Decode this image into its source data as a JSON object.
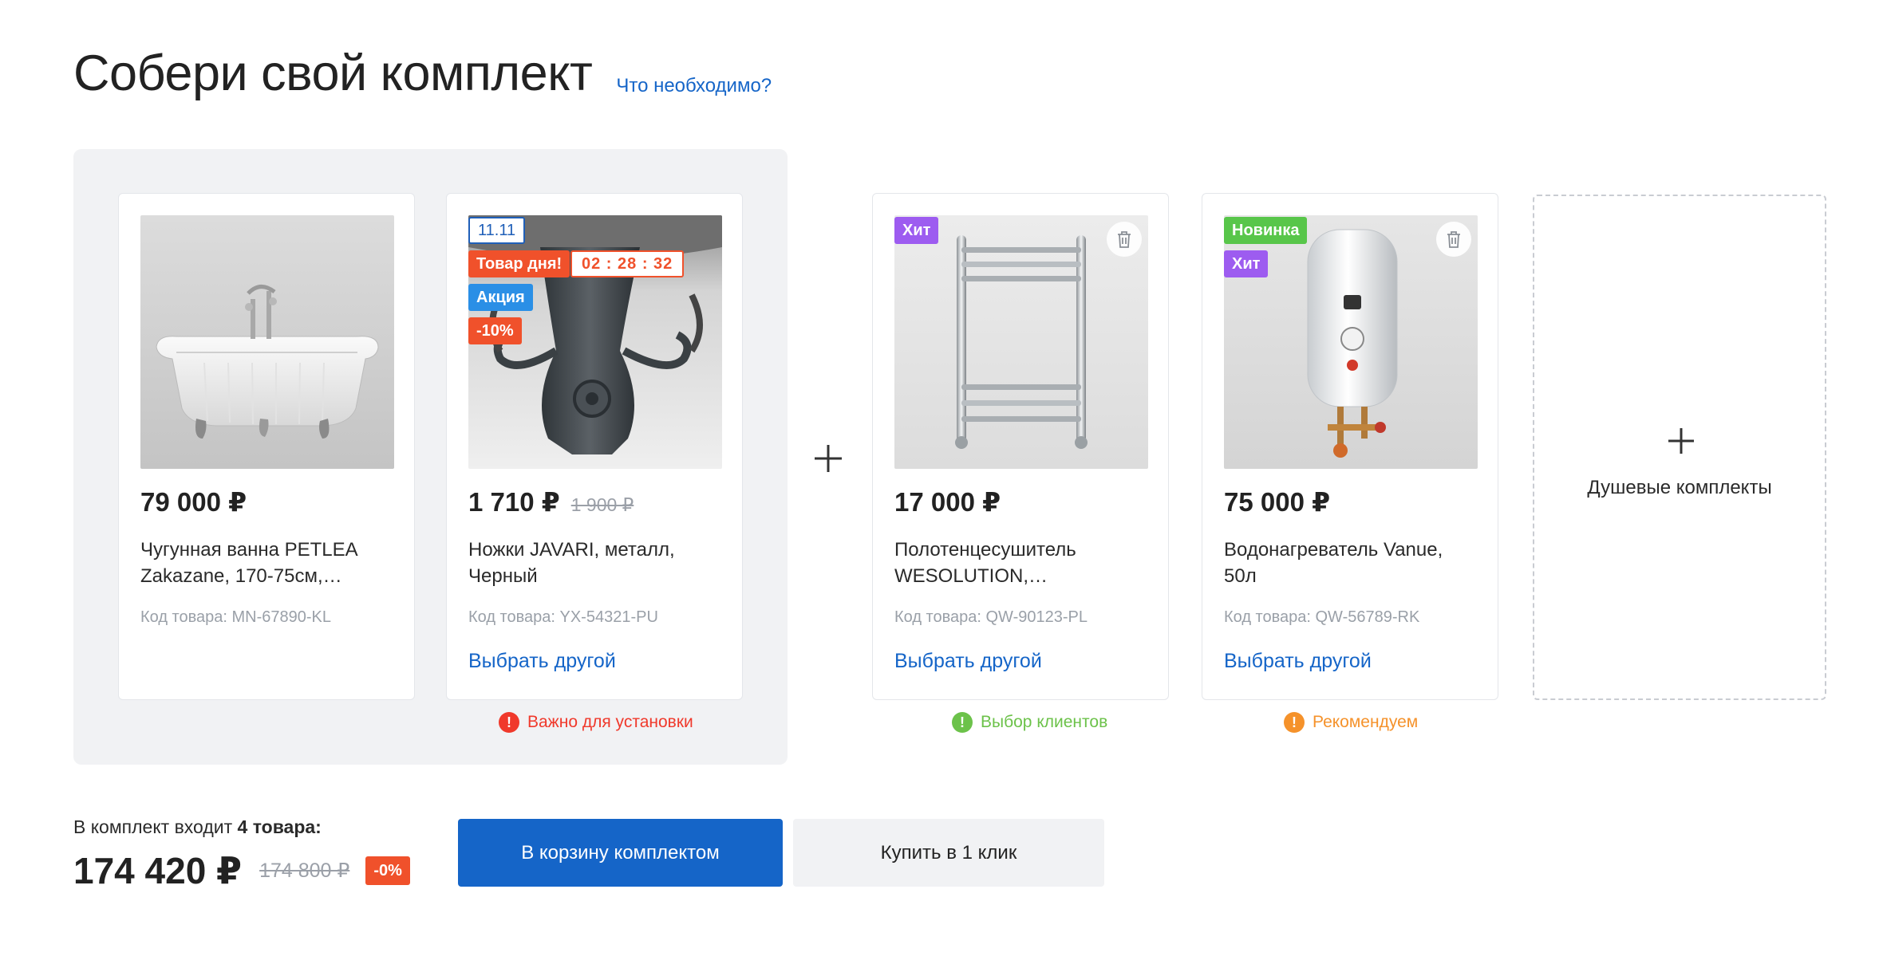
{
  "header": {
    "title": "Собери свой комплект",
    "help_link": "Что необходимо?"
  },
  "cards": [
    {
      "price": "79 000 ₽",
      "old_price": "",
      "name": "Чугунная ванна PETLEA Zakazane, 170-75см,…",
      "sku": "Код товара: MN-67890-KL",
      "image": "bathtub"
    },
    {
      "price": "1 710 ₽",
      "old_price": "1 900 ₽",
      "name": "Ножки JAVARI, металл, Черный",
      "sku": "Код товара: YX-54321-PU",
      "choose": "Выбрать другой",
      "image": "bathtub-feet",
      "badges": {
        "date": "11.11",
        "deal": "Товар дня!",
        "timer": "02 : 28 : 32",
        "promo": "Акция",
        "discount": "-10%"
      },
      "note": {
        "text": "Важно для установки",
        "color": "#f0392b"
      }
    },
    {
      "price": "17 000 ₽",
      "old_price": "",
      "name": "Полотенцесушитель WESOLUTION,…",
      "sku": "Код товара: QW-90123-PL",
      "choose": "Выбрать другой",
      "image": "towel-warmer",
      "badges": {
        "hit": "Хит"
      },
      "note": {
        "text": "Выбор клиентов",
        "color": "#6cc24a"
      }
    },
    {
      "price": "75 000 ₽",
      "old_price": "",
      "name": "Водонагреватель Vanue, 50л",
      "sku": "Код товара: QW-56789-RK",
      "choose": "Выбрать другой",
      "image": "water-heater",
      "badges": {
        "new": "Новинка",
        "hit": "Хит"
      },
      "note": {
        "text": "Рекомендуем",
        "color": "#f5922b"
      }
    }
  ],
  "add_card": {
    "label": "Душевые комплекты"
  },
  "summary": {
    "count_prefix": "В комплект входит",
    "count": "4 товара:",
    "total": "174 420 ₽",
    "total_old": "174 800 ₽",
    "discount": "-0%"
  },
  "buttons": {
    "cart": "В корзину комплектом",
    "one_click": "Купить в 1 клик"
  },
  "colors": {
    "accent": "#1565c8",
    "sale": "#f0512b",
    "panel": "#f1f2f4"
  }
}
